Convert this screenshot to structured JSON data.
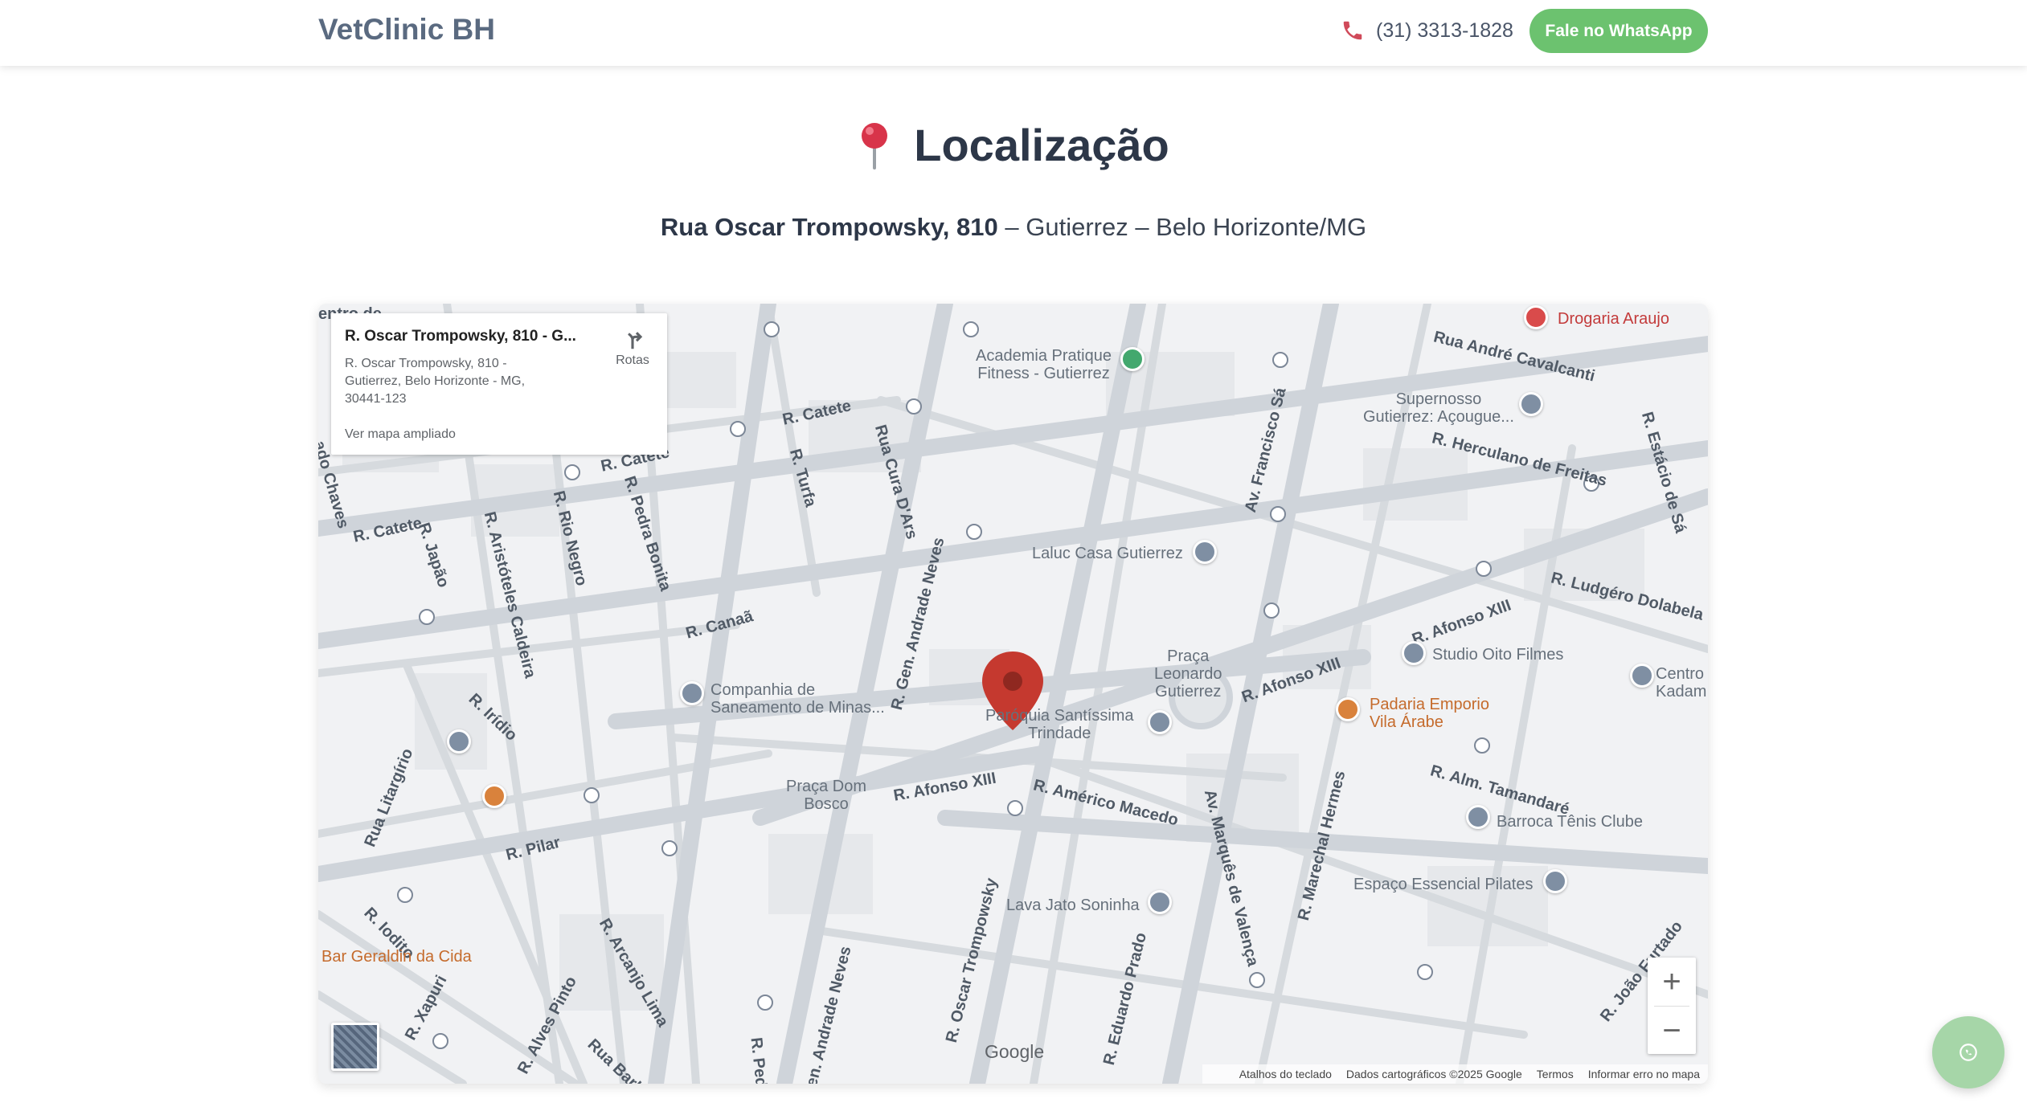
{
  "header": {
    "brand": "VetClinic BH",
    "phone": "(31) 3313-1828",
    "whatsapp_label": "Fale no WhatsApp"
  },
  "section": {
    "title": "Localização",
    "address_bold": "Rua Oscar Trompowsky, 810",
    "address_rest": " – Gutierrez – Belo Horizonte/MG"
  },
  "map": {
    "info_title": "R. Oscar Trompowsky, 810 - G...",
    "info_address": "R. Oscar Trompowsky, 810 - Gutierrez, Belo Horizonte - MG, 30441-123",
    "info_link": "Ver mapa ampliado",
    "directions_label": "Rotas",
    "streets": {
      "catete_1": "R. Catete",
      "catete_2": "R. Catete",
      "catete_3": "R. Catete",
      "canaa": "R. Canaã",
      "japao": "R. Japão",
      "aristoteles": "R. Aristóteles Caldeira",
      "rio_negro": "R. Rio Negro",
      "pedra_bonita": "R. Pedra Bonita",
      "turfa": "R. Turfa",
      "cura_dars": "Rua Cura D'Ars",
      "andrade_neves": "R. Gen. Andrade Neves",
      "andrade_neves_2": "en. Andrade Neves",
      "francisco_sa": "Av. Francisco Sá",
      "andre_cavalcanti": "Rua André Cavalcanti",
      "herculano": "R. Herculano de Freitas",
      "estacio": "R. Estácio de Sá",
      "ludgero": "R. Ludgéro Dolabela",
      "afonso_1": "R. Afonso XIII",
      "afonso_2": "R. Afonso XIII",
      "afonso_3": "R. Afonso XIII",
      "iridio": "R. Irídio",
      "litargirio": "Rua Litargírio",
      "pilar": "R. Pilar",
      "americo": "R. Américo Macedo",
      "alm_tamandare": "R. Alm. Tamandaré",
      "marques": "Av. Marquês de Valença",
      "marechal": "R. Marechal Hermes",
      "oscar": "R. Oscar Trompowsky",
      "eduardo_prado": "R. Eduardo Prado",
      "iodito": "R. Iodito",
      "arcanjo": "R. Arcanjo Lima",
      "xapuri": "R. Xapuri",
      "alves_pinto": "R. Alves Pinto",
      "barbosa": "Rua Barbo",
      "pedr": "R. Pedr",
      "joao_furtado": "R. João Furtado",
      "centro_de": "entro de",
      "chaves": "ado Chaves"
    },
    "pois": {
      "academia": "Academia Pratique\nFitness - Gutierrez",
      "drogaria": "Drogaria Araujo",
      "supernosso": "Supernosso\nGutierrez: Açougue...",
      "laluc": "Laluc Casa Gutierrez",
      "praca_leonardo": "Praça\nLeonardo\nGutierrez",
      "studio": "Studio Oito Filmes",
      "centro_kadam": "Centro\nKadam",
      "padaria": "Padaria Emporio\nVila Árabe",
      "copasa": "Companhia de\nSaneamento de Minas...",
      "paroquia": "Paróquia Santíssima\nTrindade",
      "praca_dom": "Praça Dom\nBosco",
      "barroca": "Barroca Tênis Clube",
      "espaco": "Espaço Essencial Pilates",
      "lava_jato": "Lava Jato Soninha",
      "bar": "Bar Geraldin da Cida"
    },
    "google": "Google",
    "attribution": {
      "shortcuts": "Atalhos do teclado",
      "data": "Dados cartográficos ©2025 Google",
      "terms": "Termos",
      "report": "Informar erro no mapa"
    },
    "zoom_in": "+",
    "zoom_out": "−"
  },
  "colors": {
    "brand_text": "#5a6a80",
    "whatsapp_green": "#6cc26f",
    "phone_icon": "#d04a5a",
    "marker_red": "#c5392f",
    "map_bg": "#f1f2f4"
  }
}
